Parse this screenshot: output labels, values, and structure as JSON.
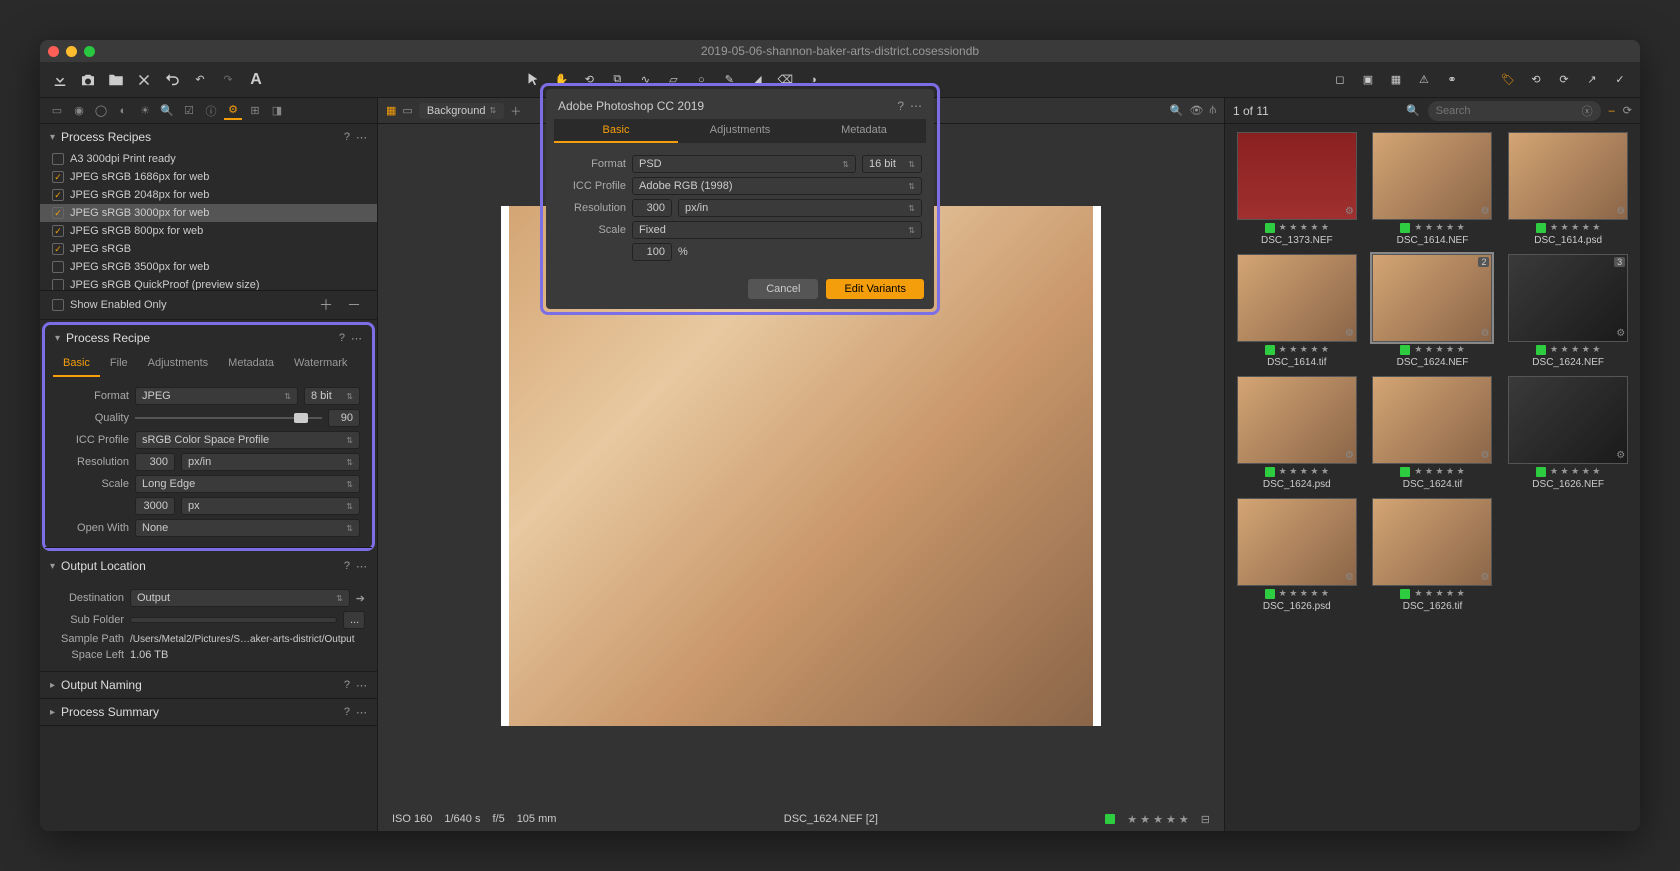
{
  "window": {
    "title": "2019-05-06-shannon-baker-arts-district.cosessiondb"
  },
  "leftPanel": {
    "recipesSection": {
      "title": "Process Recipes",
      "items": [
        {
          "checked": false,
          "label": "A3 300dpi Print ready"
        },
        {
          "checked": true,
          "label": "JPEG sRGB 1686px for web"
        },
        {
          "checked": true,
          "label": "JPEG sRGB 2048px for web"
        },
        {
          "checked": true,
          "label": "JPEG sRGB 3000px for web",
          "selected": true
        },
        {
          "checked": true,
          "label": "JPEG sRGB 800px for web"
        },
        {
          "checked": true,
          "label": "JPEG sRGB"
        },
        {
          "checked": false,
          "label": "JPEG sRGB 3500px for web"
        },
        {
          "checked": false,
          "label": "JPEG sRGB QuickProof (preview size)"
        }
      ],
      "showEnabled": "Show Enabled Only"
    },
    "recipeSection": {
      "title": "Process Recipe",
      "tabs": [
        "Basic",
        "File",
        "Adjustments",
        "Metadata",
        "Watermark"
      ],
      "format_label": "Format",
      "format": "JPEG",
      "bitdepth": "8 bit",
      "quality_label": "Quality",
      "quality": "90",
      "icc_label": "ICC Profile",
      "icc": "sRGB Color Space Profile",
      "res_label": "Resolution",
      "res": "300",
      "res_unit": "px/in",
      "scale_label": "Scale",
      "scale": "Long Edge",
      "dim": "3000",
      "dim_unit": "px",
      "open_label": "Open With",
      "open": "None"
    },
    "outputSection": {
      "title": "Output Location",
      "dest_label": "Destination",
      "dest": "Output",
      "sub_label": "Sub Folder",
      "sub_btn": "...",
      "sample_label": "Sample Path",
      "sample": "/Users/Metal2/Pictures/S…aker-arts-district/Output",
      "space_label": "Space Left",
      "space": "1.06 TB"
    },
    "namingSection": {
      "title": "Output Naming"
    },
    "summarySection": {
      "title": "Process Summary"
    }
  },
  "viewer": {
    "bg_label": "Background",
    "info": {
      "iso": "ISO 160",
      "shutter": "1/640 s",
      "aperture": "f/5",
      "focal": "105 mm",
      "file": "DSC_1624.NEF [2]",
      "stars": "★ ★ ★ ★ ★"
    }
  },
  "browser": {
    "counter": "1 of 11",
    "search_placeholder": "Search",
    "thumbs": [
      {
        "name": "DSC_1373.NEF",
        "red": true
      },
      {
        "name": "DSC_1614.NEF"
      },
      {
        "name": "DSC_1614.psd"
      },
      {
        "name": "DSC_1614.tif"
      },
      {
        "name": "DSC_1624.NEF",
        "badge": "2",
        "selected": true
      },
      {
        "name": "DSC_1624.NEF",
        "badge": "3",
        "dark": true
      },
      {
        "name": "DSC_1624.psd"
      },
      {
        "name": "DSC_1624.tif"
      },
      {
        "name": "DSC_1626.NEF",
        "dark": true
      },
      {
        "name": "DSC_1626.psd"
      },
      {
        "name": "DSC_1626.tif"
      }
    ],
    "stars": "★ ★ ★ ★ ★"
  },
  "dialog": {
    "title": "Adobe Photoshop CC 2019",
    "tabs": [
      "Basic",
      "Adjustments",
      "Metadata"
    ],
    "format_label": "Format",
    "format": "PSD",
    "bitdepth": "16 bit",
    "icc_label": "ICC Profile",
    "icc": "Adobe RGB (1998)",
    "res_label": "Resolution",
    "res": "300",
    "res_unit": "px/in",
    "scale_label": "Scale",
    "scale": "Fixed",
    "pct": "100",
    "pct_unit": "%",
    "cancel": "Cancel",
    "primary": "Edit Variants"
  }
}
